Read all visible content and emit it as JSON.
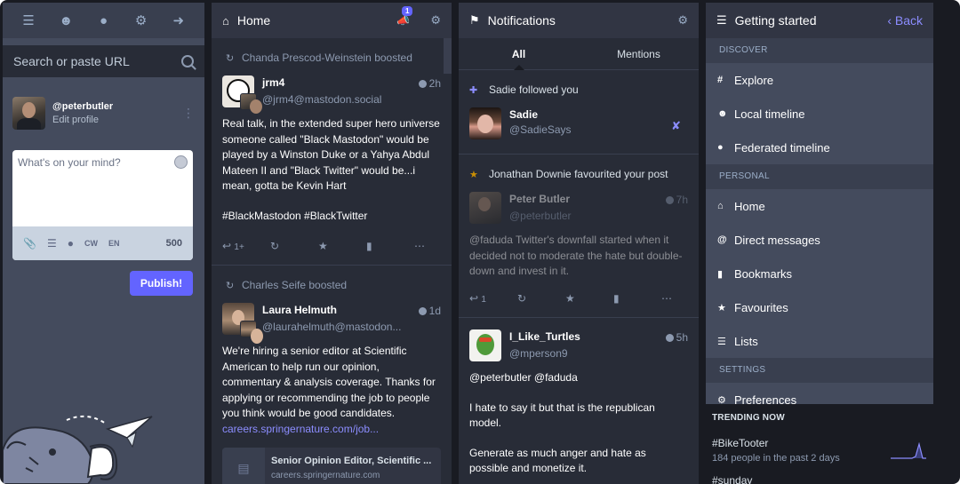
{
  "compose_nav": {
    "icons": [
      "menu-icon",
      "people-icon",
      "globe-icon",
      "gear-icon",
      "logout-icon"
    ]
  },
  "search": {
    "placeholder": "Search or paste URL"
  },
  "account": {
    "handle": "@peterbutler",
    "edit_label": "Edit profile"
  },
  "composer": {
    "placeholder": "What's on your mind?",
    "cw_label": "CW",
    "lang_label": "EN",
    "char_count": "500",
    "publish_label": "Publish!"
  },
  "home": {
    "title": "Home",
    "announcement_count": "1",
    "statuses": [
      {
        "boosted_by": "Chanda Prescod-Weinstein boosted",
        "display_name": "jrm4",
        "acct": "@jrm4@mastodon.social",
        "time": "2h",
        "paragraphs": [
          "Real talk, in the extended super hero universe someone called \"Black Mastodon\" would be played by a Winston Duke or a Yahya Abdul Mateen II and \"Black Twitter\" would be...i mean, gotta be Kevin Hart",
          "#BlackMastodon #BlackTwitter"
        ],
        "reply_count": "1+"
      },
      {
        "boosted_by": "Charles Seife boosted",
        "display_name": "Laura Helmuth",
        "acct": "@laurahelmuth@mastodon...",
        "time": "1d",
        "paragraphs": [
          "We're hiring a senior editor at Scientific American to help run our opinion, commentary & analysis coverage. Thanks for applying or recommending the job to people you think would be good candidates."
        ],
        "link": "careers.springernature.com/job...",
        "card_title": "Senior Opinion Editor, Scientific ...",
        "card_url": "careers.springernature.com"
      }
    ]
  },
  "notifications": {
    "title": "Notifications",
    "tab_all": "All",
    "tab_mentions": "Mentions",
    "follow": {
      "text": "Sadie followed you",
      "display_name": "Sadie",
      "acct": "@SadieSays"
    },
    "favourite": {
      "text": "Jonathan Downie favourited your post",
      "display_name": "Peter Butler",
      "acct": "@peterbutler",
      "time": "7h",
      "content": "@faduda Twitter's downfall started when it decided not to moderate the hate but double-down and invest in it.",
      "reply_count": "1"
    },
    "mention": {
      "display_name": "I_Like_Turtles",
      "acct": "@mperson9",
      "time": "5h",
      "paragraphs": [
        "@peterbutler @faduda",
        "I hate to say it but that is the republican model.",
        "Generate as much anger and hate as possible and monetize it."
      ]
    }
  },
  "getting_started": {
    "title": "Getting started",
    "back_label": "Back",
    "sections": {
      "discover": "DISCOVER",
      "personal": "PERSONAL",
      "settings": "SETTINGS"
    },
    "discover_items": [
      "Explore",
      "Local timeline",
      "Federated timeline"
    ],
    "personal_items": [
      "Home",
      "Direct messages",
      "Bookmarks",
      "Favourites",
      "Lists"
    ],
    "settings_items": [
      "Preferences"
    ]
  },
  "trending": {
    "title": "TRENDING NOW",
    "items": [
      {
        "tag": "#BikeTooter",
        "sub": "184 people in the past 2 days"
      },
      {
        "tag": "#sunday",
        "sub": ""
      }
    ]
  },
  "colors": {
    "accent": "#6364ff",
    "link": "#8c8dff",
    "favourite": "#ca8f04",
    "background": "#191b22",
    "panel": "#282c37"
  }
}
